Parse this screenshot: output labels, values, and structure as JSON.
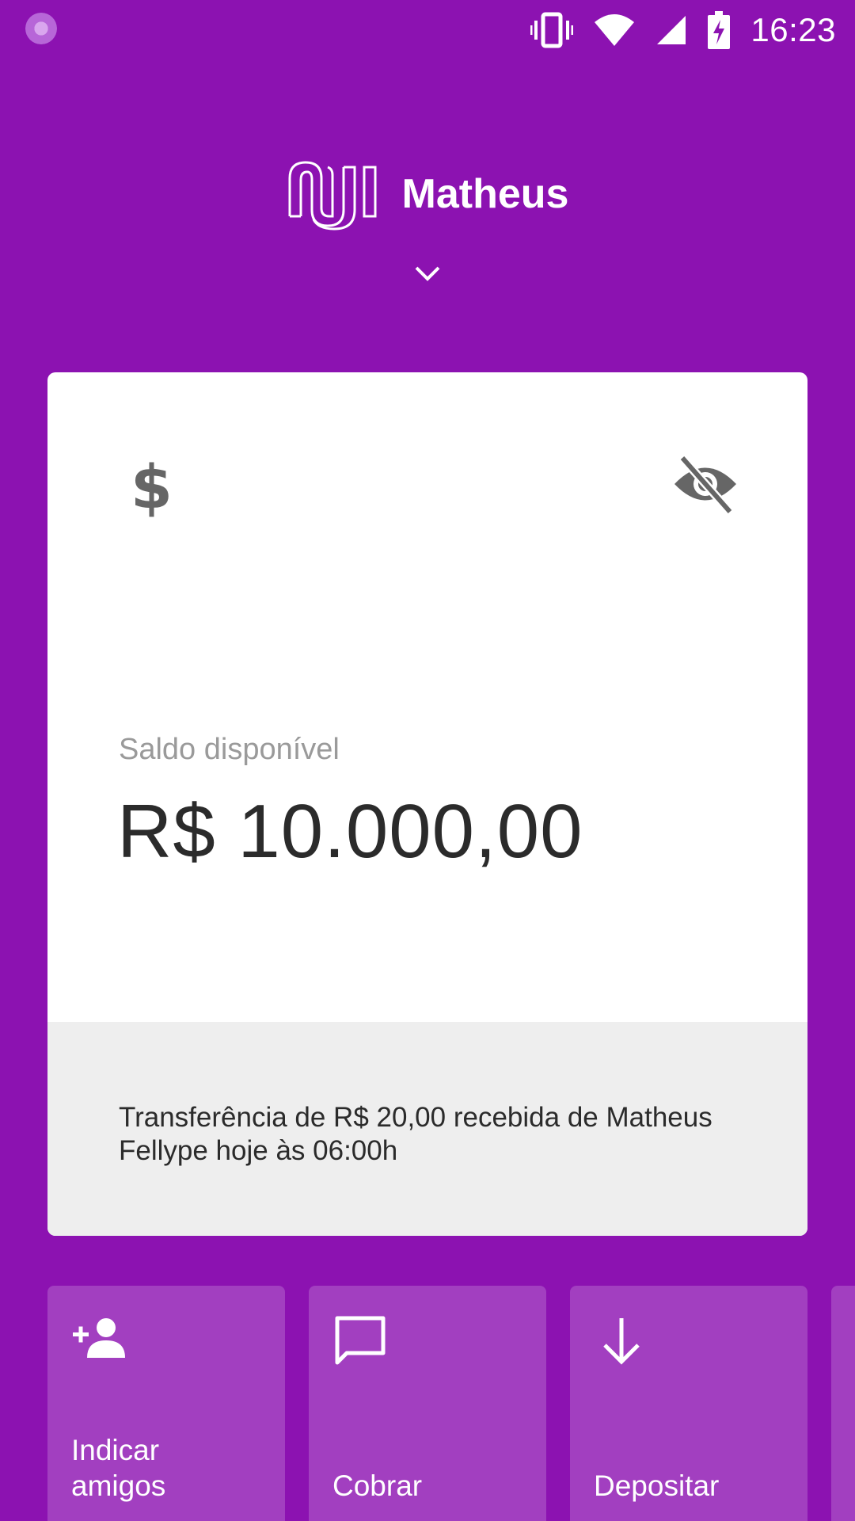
{
  "status_bar": {
    "time": "16:23",
    "icons": [
      "app-notification-icon",
      "vibrate-icon",
      "wifi-icon",
      "cell-signal-icon",
      "battery-charging-icon"
    ]
  },
  "header": {
    "logo": "nu-logo",
    "user_name": "Matheus",
    "expand_icon": "chevron-down-icon"
  },
  "balance_card": {
    "icon": "dollar-icon",
    "visibility_icon": "eye-off-icon",
    "label": "Saldo disponível",
    "value": "R$ 10.000,00",
    "last_activity": "Transferência de R$ 20,00 recebida de Matheus Fellype hoje às 06:00h"
  },
  "actions": [
    {
      "label": "Indicar amigos",
      "icon": "person-add-icon"
    },
    {
      "label": "Cobrar",
      "icon": "chat-bubble-icon"
    },
    {
      "label": "Depositar",
      "icon": "arrow-down-icon"
    },
    {
      "label": "",
      "icon": ""
    }
  ],
  "colors": {
    "brand_purple": "#8C12B1",
    "tile_purple": "#A23FC0",
    "card_footer": "#EEEEEE"
  }
}
